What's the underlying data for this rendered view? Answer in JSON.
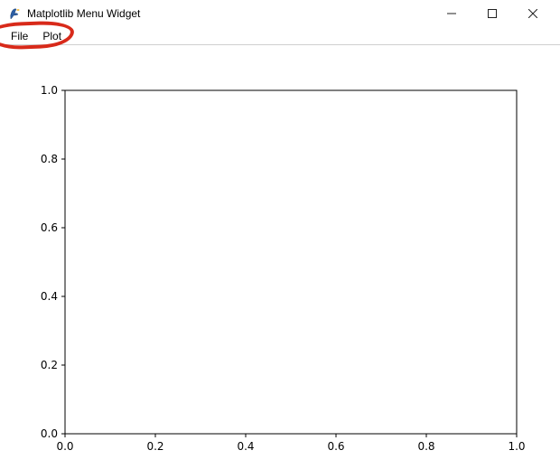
{
  "window": {
    "title": "Matplotlib Menu Widget"
  },
  "menubar": {
    "file_label": "File",
    "plot_label": "Plot"
  },
  "chart_data": {
    "type": "line",
    "series": [],
    "xlim": [
      0.0,
      1.0
    ],
    "ylim": [
      0.0,
      1.0
    ],
    "xticks": [
      "0.0",
      "0.2",
      "0.4",
      "0.6",
      "0.8",
      "1.0"
    ],
    "yticks": [
      "0.0",
      "0.2",
      "0.4",
      "0.6",
      "0.8",
      "1.0"
    ],
    "title": "",
    "xlabel": "",
    "ylabel": ""
  }
}
